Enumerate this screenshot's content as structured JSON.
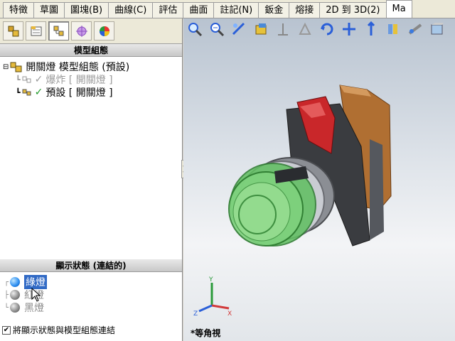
{
  "tabs": [
    "特徵",
    "草圖",
    "圖塊(B)",
    "曲線(C)",
    "評估",
    "曲面",
    "註記(N)",
    "鈑金",
    "熔接",
    "2D 到 3D(2)",
    "Ma"
  ],
  "active_tab_index": 10,
  "config_panel": {
    "title": "模型組態",
    "root": {
      "label": "開關燈 模型組態  (預設)",
      "icon": "assembly-icon"
    },
    "items": [
      {
        "label": "爆炸 [ 開關燈 ]",
        "grayed": true
      },
      {
        "label": "預設 [ 開關燈 ]",
        "grayed": false
      }
    ]
  },
  "display_panel": {
    "title": "顯示狀態 (連結的)",
    "states": [
      {
        "label": "綠燈",
        "selected": true,
        "color": "#2a8cf0"
      },
      {
        "label": "紅燈",
        "selected": false,
        "color": "#888888"
      },
      {
        "label": "黑燈",
        "selected": false,
        "color": "#888888"
      }
    ]
  },
  "link_checkbox": {
    "label": "將顯示狀態與模型組態連結",
    "checked": true
  },
  "view": {
    "name": "*等角視"
  },
  "colors": {
    "selection": "#316ac5",
    "green_lens": "#6fcf72",
    "red_button": "#d23a3a",
    "housing": "#b3773e"
  }
}
